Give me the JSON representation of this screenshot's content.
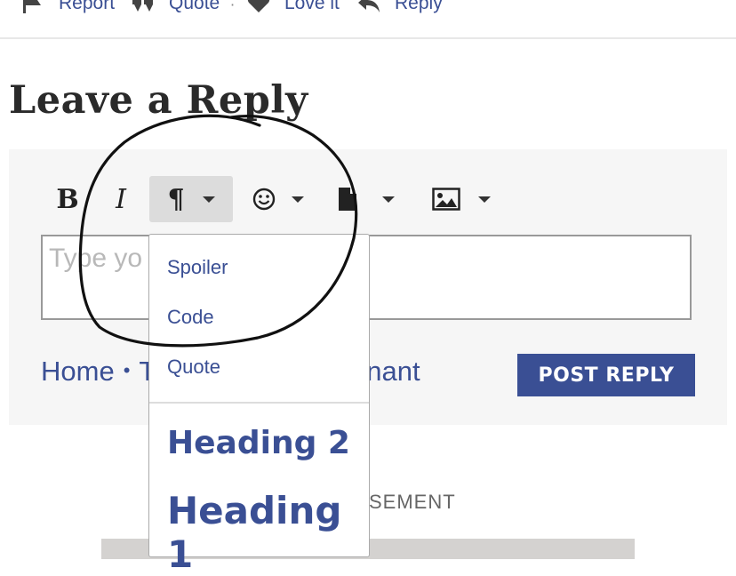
{
  "post_actions": {
    "report": "Report",
    "quote": "Quote",
    "separator": "·",
    "love": "Love it",
    "reply": "Reply"
  },
  "section_title": "Leave a Reply",
  "toolbar": {
    "bold": "B",
    "italic": "I",
    "paragraph": "¶",
    "icons": [
      "bold-icon",
      "italic-icon",
      "paragraph-icon",
      "smiley-icon",
      "file-icon",
      "image-icon"
    ]
  },
  "editor": {
    "placeholder": "Type yo"
  },
  "breadcrumb": {
    "home": "Home",
    "separator": "•",
    "next": "T",
    "trailing": "gnant"
  },
  "post_button": "POST REPLY",
  "advert_label": "SEMENT",
  "dropdown": {
    "items": [
      "Spoiler",
      "Code",
      "Quote",
      "Heading 2",
      "Heading 1"
    ]
  },
  "colors": {
    "accent": "#3a4f94",
    "toolbar_bg": "#f6f6f6",
    "active_tool": "#dcdcdc"
  }
}
